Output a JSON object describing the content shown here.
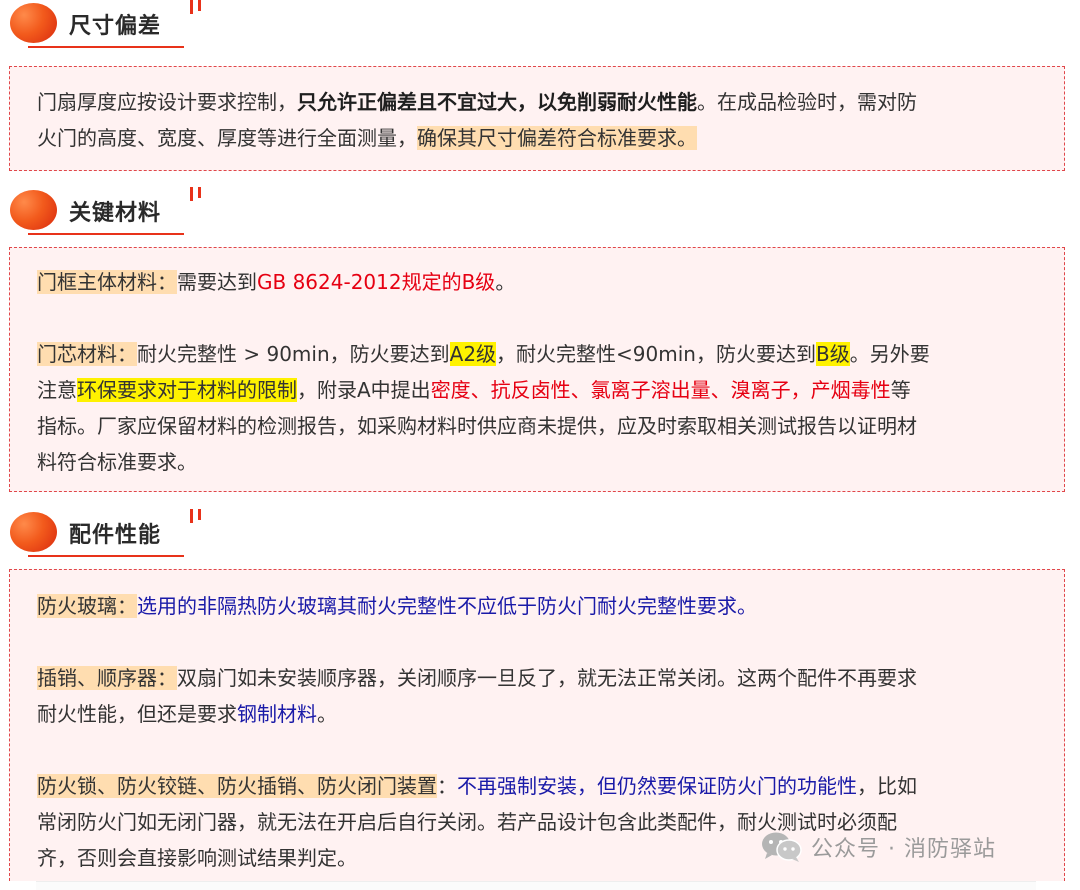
{
  "sections": [
    {
      "title": "尺寸偏差",
      "para1": {
        "t1": "门扇厚度应按设计要求控制，",
        "b1": "只允许正偏差且不宜过大，以免削弱耐火性能",
        "t2": "。在成品检验时，需对防",
        "t3": "火门的高度、宽度、厚度等进行全面测量，",
        "h1": "确保其尺寸偏差符合标准要求。"
      }
    },
    {
      "title": "关键材料",
      "para1": {
        "label": "门框主体材料：",
        "t1": "需要达到",
        "r1": "GB 8624-2012规定的B级",
        "t2": "。"
      },
      "para2": {
        "label": "门芯材料：",
        "t1": "耐火完整性 > 90min，防火要达到",
        "y1": "A2级",
        "t2": "，耐火完整性<90min，防火要达到",
        "y2": "B级",
        "t3": "。另外要",
        "t4": "注意",
        "y3": "环保要求对于材料的限制",
        "t5": "，附录A中提出",
        "r1": "密度、抗反卤性、氯离子溶出量、溴离子，产烟毒性",
        "t6": "等",
        "t7": "指标。厂家应保留材料的检测报告，如采购材料时供应商未提供，应及时索取相关测试报告以证明材",
        "t8": "料符合标准要求。"
      }
    },
    {
      "title": "配件性能",
      "para1": {
        "label": "防火玻璃：",
        "bl1": "选用的非隔热防火玻璃其耐火完整性不应低于防火门耐火完整性要求。"
      },
      "para2": {
        "label": "插销、顺序器：",
        "t1": "双扇门如未安装顺序器，关闭顺序一旦反了，就无法正常关闭。这两个配件不再要求",
        "t2": "耐火性能，但还是要求",
        "bl1": "钢制材料",
        "t3": "。"
      },
      "para3": {
        "label": "防火锁、防火铰链、防火插销、防火闭门装置",
        "t1": "：",
        "bl1": "不再强制安装，但仍然要保证防火门的功能性",
        "t2": "，比如",
        "t3": "常闭防火门如无闭门器，就无法在开启后自行关闭。若产品设计包含此类配件，耐火测试时必须配",
        "t4": "齐，否则会直接影响测试结果判定。"
      }
    }
  ],
  "watermark": {
    "text": "公众号 · 消防驿站",
    "icon": "wechat-icon"
  },
  "colors": {
    "accent_red": "#e8321a",
    "box_border": "#e0474a",
    "box_bg": "#fff2f2",
    "highlight_orange": "#ffddb0",
    "highlight_yellow": "#fff200",
    "text_red": "#e60012",
    "text_blue": "#1a1aa8"
  }
}
